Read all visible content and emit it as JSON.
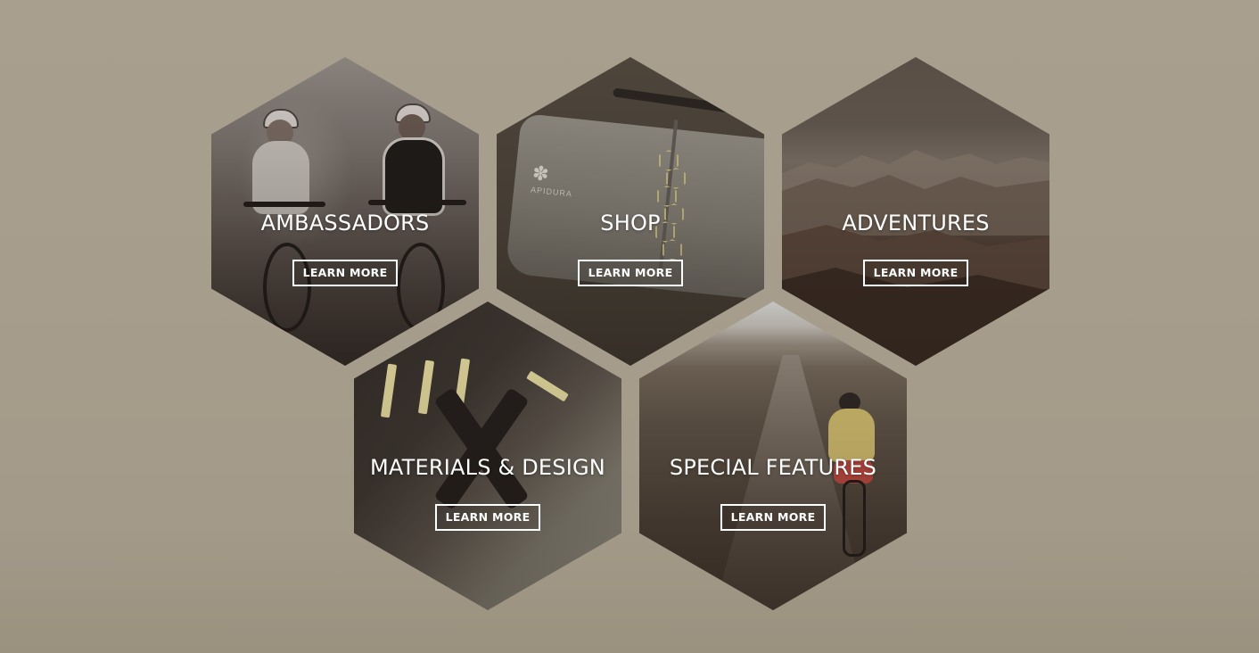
{
  "tiles": [
    {
      "title": "AMBASSADORS",
      "button": "LEARN MORE"
    },
    {
      "title": "SHOP",
      "button": "LEARN MORE"
    },
    {
      "title": "ADVENTURES",
      "button": "LEARN MORE"
    },
    {
      "title": "MATERIALS & DESIGN",
      "button": "LEARN MORE"
    },
    {
      "title": "SPECIAL FEATURES",
      "button": "LEARN MORE"
    }
  ],
  "shop_bag_brand": "APIDURA",
  "colors": {
    "page_background": "#a99f8f",
    "title_text": "#ffffff",
    "button_border": "#ffffff",
    "hex_accent": "#c2b77a"
  }
}
